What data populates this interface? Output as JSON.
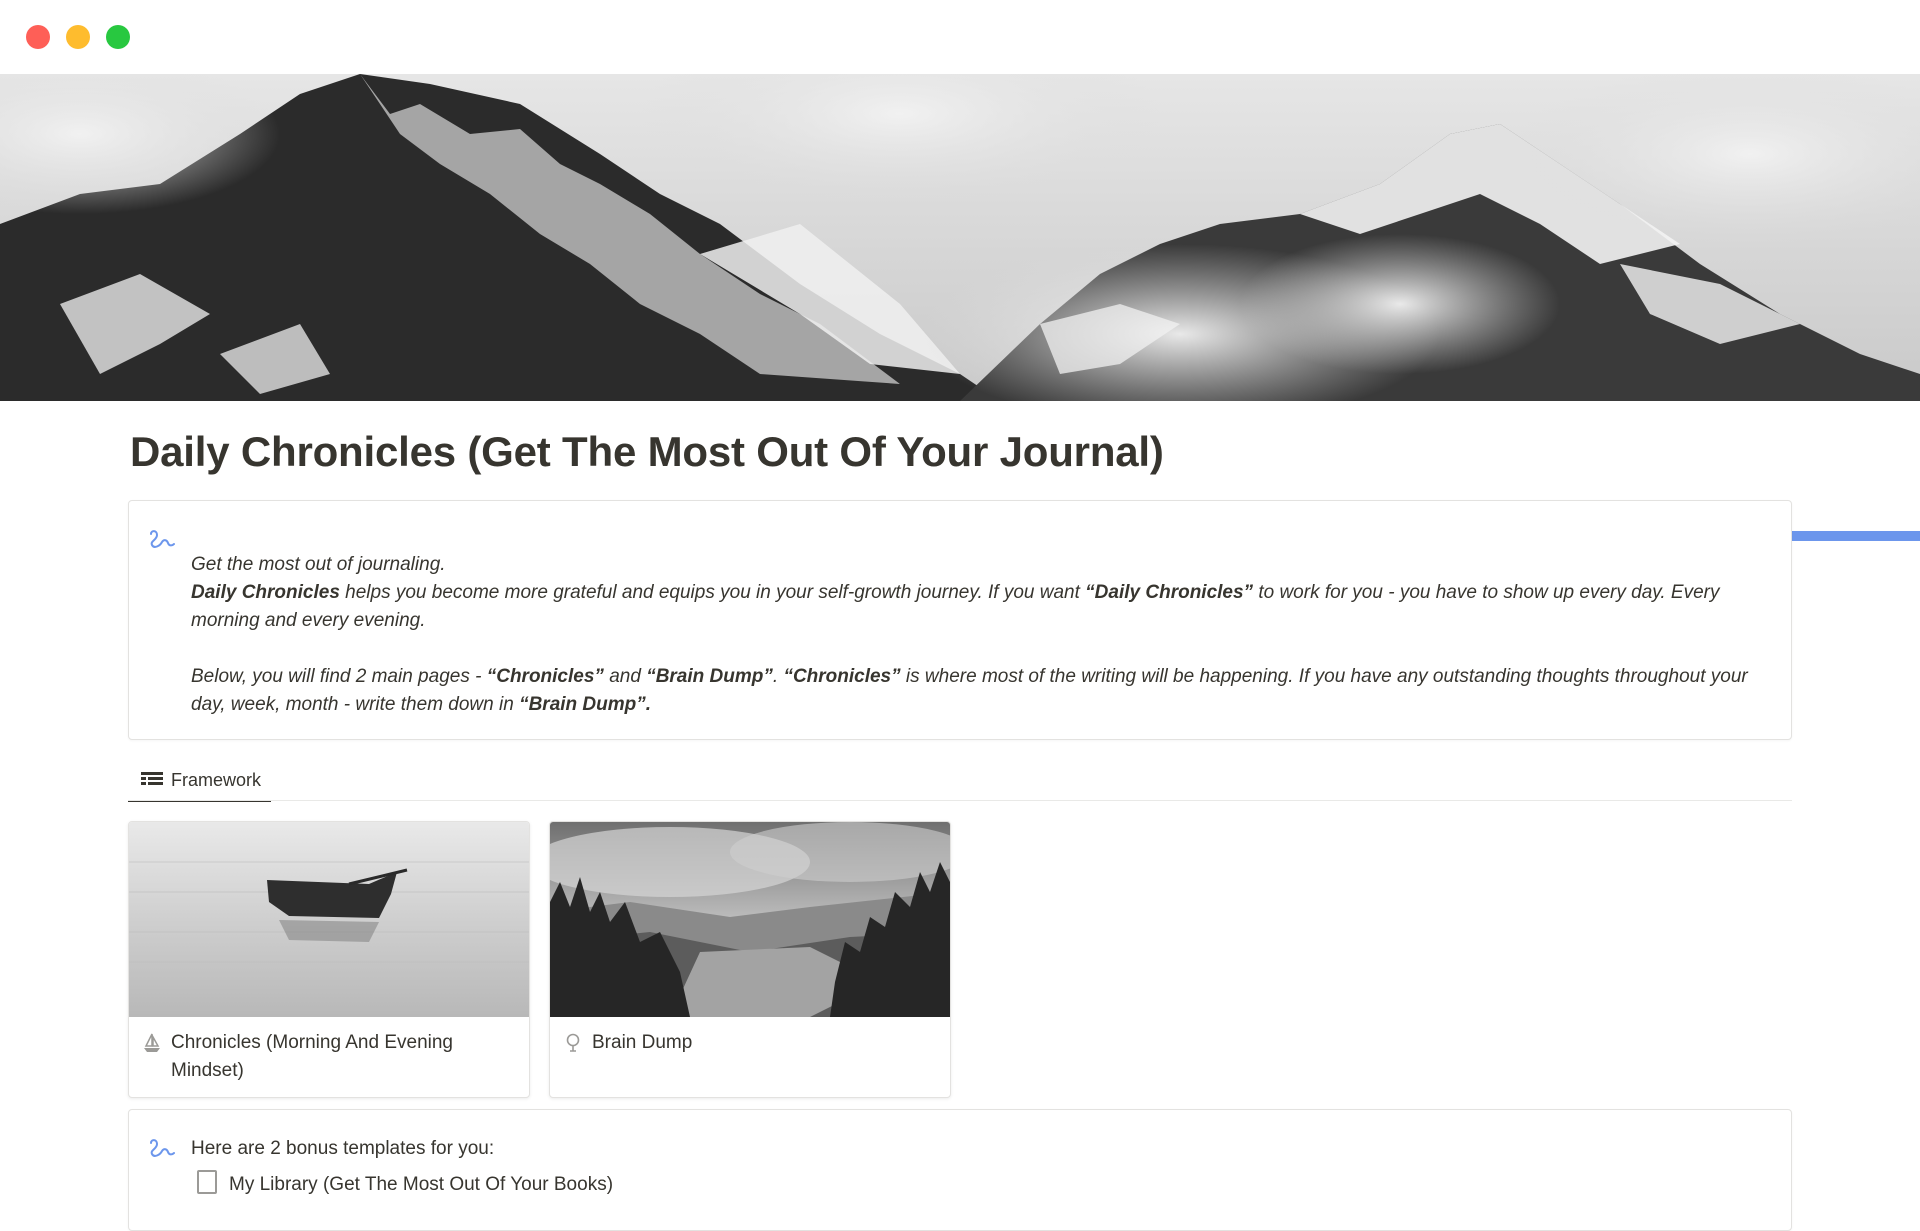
{
  "window": {
    "controls": [
      "close",
      "minimize",
      "maximize"
    ]
  },
  "cover": {
    "description_icon": "mountain-cover-image"
  },
  "page": {
    "title": "Daily Chronicles (Get The Most Out Of Your Journal)"
  },
  "intro_callout": {
    "icon": "scribble-icon",
    "line1": "Get the most out of journaling.",
    "p2_bold1": "Daily Chronicles",
    "p2_text1": " helps you become more grateful and equips you in your self-growth journey. If you want ",
    "p2_bold2": "“Daily Chronicles”",
    "p2_text2": " to work for you - you have to show up every day. Every morning and every evening.",
    "p3_text1": "Below, you will find 2 main pages - ",
    "p3_bold1": "“Chronicles”",
    "p3_text2": " and ",
    "p3_bold2": "“Brain Dump”",
    "p3_text3": ". ",
    "p3_bold3": "“Chronicles”",
    "p3_text4": " is where most of the writing will be happening. If you have any outstanding thoughts throughout your day, week, month - write them down in ",
    "p3_bold4": "“Brain Dump”.",
    "accent_color": "#6c96ec"
  },
  "view_tab": {
    "label": "Framework",
    "icon": "table-icon"
  },
  "cards": [
    {
      "title": "Chronicles (Morning And Evening Mindset)",
      "icon": "sailboat-icon",
      "image": "boat-on-lake"
    },
    {
      "title": "Brain Dump",
      "icon": "brain-icon",
      "image": "forest-valley"
    }
  ],
  "bonus_callout": {
    "icon": "scribble-icon",
    "text": "Here are 2 bonus templates for you:",
    "item1": "My Library (Get The Most Out Of Your Books)"
  }
}
